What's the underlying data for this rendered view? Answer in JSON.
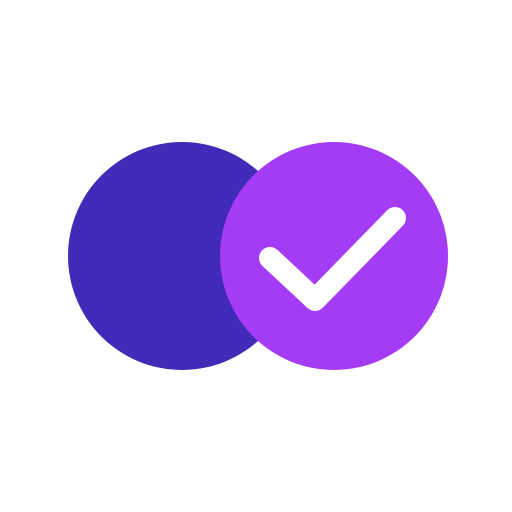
{
  "logo": {
    "name": "overlapping-circles-check-logo",
    "icon": "checkmark-icon",
    "colors": {
      "background": "#ffffff",
      "back_circle": "#402bb8",
      "front_circle": "#a53cf5",
      "check": "#ffffff"
    }
  }
}
